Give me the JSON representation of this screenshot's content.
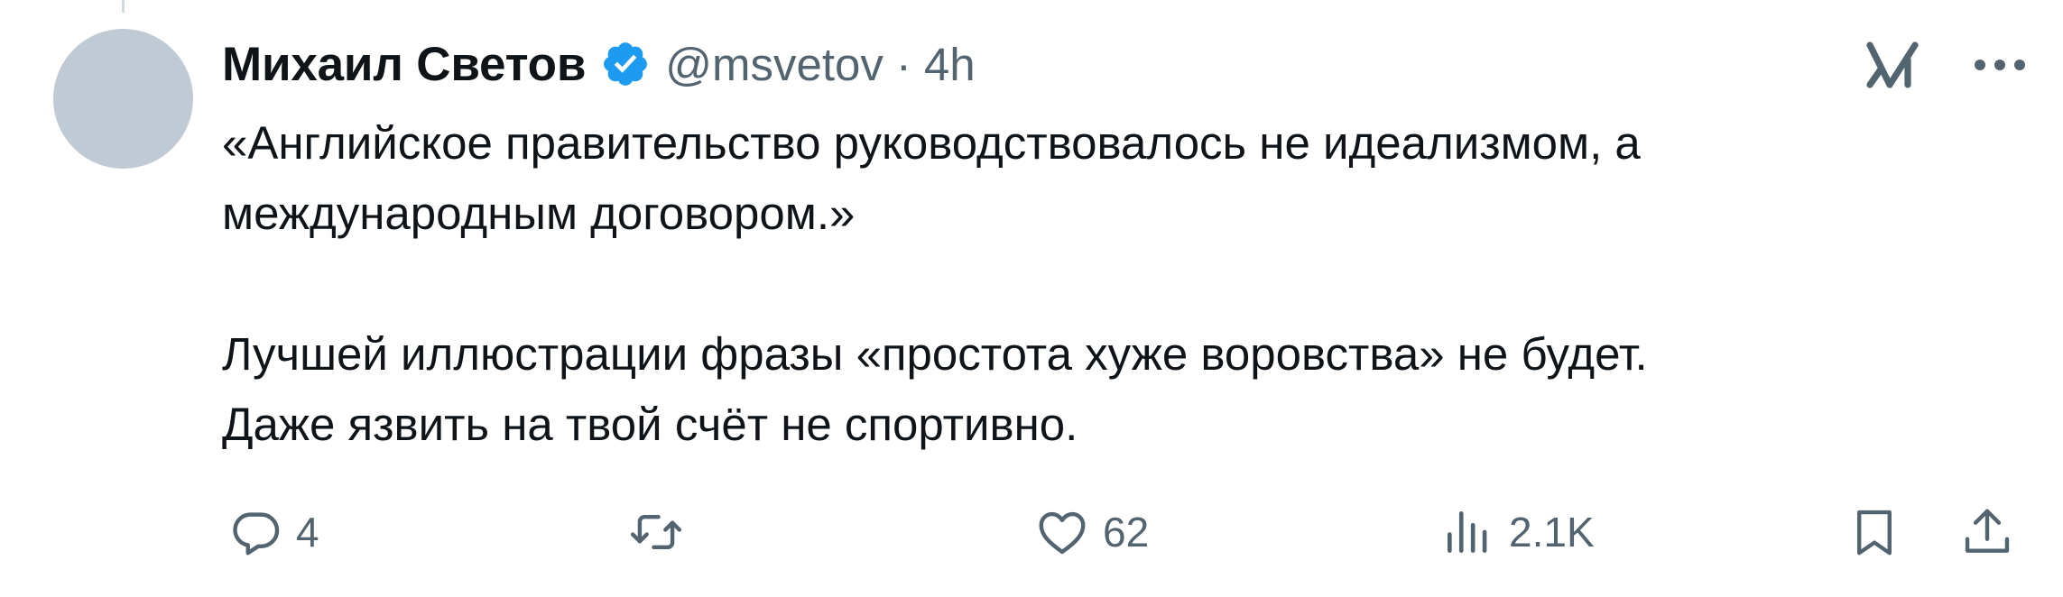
{
  "tweet": {
    "author": {
      "display_name": "Михаил Светов",
      "handle": "@msvetov",
      "verified": true,
      "avatar_color": "#bfcad5"
    },
    "separator": "·",
    "time": "4h",
    "text_paragraph_1_line_1": "«Английское правительство руководствовалось не идеализмом, а",
    "text_paragraph_1_line_2": "международным договором.»",
    "text_paragraph_2_line_1": "Лучшей иллюстрации фразы «простота хуже воровства» не будет.",
    "text_paragraph_2_line_2": "Даже язвить на твой счёт не спортивно.",
    "actions": {
      "replies": "4",
      "reposts": "",
      "likes": "62",
      "views": "2.1K"
    }
  },
  "icons": {
    "verified": "verified-badge-icon",
    "grok": "grok-icon",
    "more": "more-icon",
    "reply": "reply-icon",
    "repost": "repost-icon",
    "like": "heart-icon",
    "views": "views-icon",
    "bookmark": "bookmark-icon",
    "share": "share-icon"
  },
  "colors": {
    "text": "#0f1419",
    "secondary": "#536471",
    "verified_blue": "#1d9bf0",
    "avatar": "#bfcad5"
  }
}
